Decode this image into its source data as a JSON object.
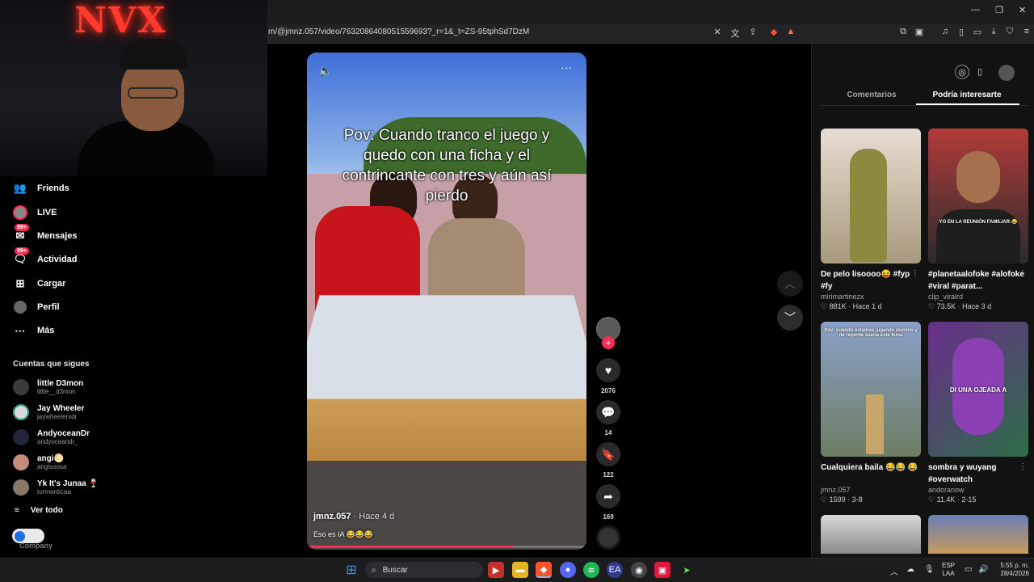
{
  "browser": {
    "url": "m/@jmnz.057/video/7632086408051559693?_r=1&_t=ZS-95tphSd7DzM"
  },
  "webcam": {
    "neon_sign": "NVX"
  },
  "sidebar": {
    "items": [
      {
        "label": "Friends",
        "icon": "friends-icon"
      },
      {
        "label": "LIVE",
        "icon": "live-icon"
      },
      {
        "label": "Mensajes",
        "icon": "messages-icon",
        "badge": "99+"
      },
      {
        "label": "Actividad",
        "icon": "activity-icon",
        "badge": "99+"
      },
      {
        "label": "Cargar",
        "icon": "upload-icon"
      },
      {
        "label": "Perfil",
        "icon": "profile-icon"
      },
      {
        "label": "Más",
        "icon": "more-icon"
      }
    ],
    "following_title": "Cuentas que sigues",
    "following": [
      {
        "name": "little D3mon",
        "handle": "little__d3mon"
      },
      {
        "name": "Jay Wheeler",
        "handle": "jaywheelersdr"
      },
      {
        "name": "AndyoceanDr",
        "handle": "andyoceandr_"
      },
      {
        "name": "angi🌕",
        "handle": "angisoosa"
      },
      {
        "name": "Yk It's Junaa 🍷",
        "handle": "tormenticaa"
      }
    ],
    "see_all": "Ver todo",
    "company": "Company"
  },
  "video": {
    "caption": "Pov: Cuando tranco el juego y quedo con una ficha y el contrincante con tres y aún así pierdo",
    "username": "jmnz.057",
    "time": " · Hace 4 d",
    "description": "Eso es IA 😂😂😂",
    "progress_fraction": 0.74
  },
  "actions": {
    "likes": "2076",
    "comments": "14",
    "saves": "122",
    "shares": "169"
  },
  "right_panel": {
    "tab_comments": "Comentarios",
    "tab_related": "Podría interesarte",
    "cards": [
      {
        "title": "De pelo lisoooo😝 #fyp #fy",
        "user": "mirimartinezx",
        "stats": "♡ 881K · Hace 1 d",
        "thumb_color": "#c9b8a8",
        "overlay": ""
      },
      {
        "title": "#planetaalofoke #alofoke #viral #parat...",
        "user": "clip_viralrd",
        "stats": "♡ 73.5K · Hace 3 d",
        "thumb_color": "#3a3a3e",
        "overlay": "YO EN LA REUNIÓN FAMILIAR:😂"
      },
      {
        "title": "Cualquiera baila 😂😂 😂",
        "user": "jmnz.057",
        "stats": "♡ 1599 · 3-8",
        "thumb_color": "#7f8f73",
        "overlay": "Pov: cuando estamos jugando dominó y de repente suena este tema"
      },
      {
        "title": "sombra y wuyang #overwatch",
        "user": "andoranow",
        "stats": "♡ 11.4K · 2-15",
        "thumb_color": "#5a2f7a",
        "overlay": "DI UNA OJEADA A"
      }
    ]
  },
  "taskbar": {
    "search_label": "Buscar",
    "lang_line1": "ESP",
    "lang_line2": "LAA",
    "time": "5:55 p. m.",
    "date": "28/4/2026"
  },
  "colors": {
    "accent": "#fe2c55",
    "background": "#000000",
    "panel": "#121212"
  }
}
